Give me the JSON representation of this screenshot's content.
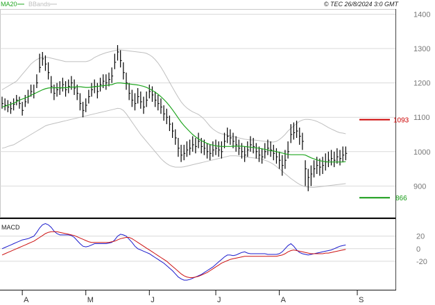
{
  "legend": {
    "ma_label": "MA20",
    "bbands_label": "BBands",
    "ma_color": "#1fa51f",
    "bbands_color": "#bfbfbf"
  },
  "header": {
    "copyright": "© TEC 26/8/2024 3:0 GMT"
  },
  "macd_panel": {
    "label": "MACD"
  },
  "colors": {
    "candles": "#000000",
    "resistance": "#cc0000",
    "support": "#119911",
    "macd_line": "#1a1acc",
    "signal_line": "#cc1111",
    "grid": "#d9d9d9",
    "axis_text": "#777777"
  },
  "chart_data": [
    {
      "type": "line",
      "title": "",
      "price_axis_ticks": [
        "1400",
        "1300",
        "1200",
        "1100",
        "1000",
        "900"
      ],
      "tick_values": [
        1400,
        1300,
        1200,
        1100,
        1000,
        900
      ],
      "ylim": [
        810,
        1415
      ],
      "x_tick_labels": [
        "A",
        "M",
        "J",
        "J",
        "A",
        "S"
      ],
      "x_ticks_index": [
        7,
        29,
        51,
        74,
        96,
        123
      ],
      "x_index_range": [
        0,
        126
      ],
      "grid": true,
      "levels": [
        {
          "name": "resistance",
          "value": 1093,
          "label": "1093"
        },
        {
          "name": "support",
          "value": 866,
          "label": "866"
        }
      ],
      "ohlc_close": [
        1140,
        1135,
        1130,
        1125,
        1138,
        1150,
        1140,
        1120,
        1145,
        1160,
        1175,
        1170,
        1200,
        1245,
        1270,
        1255,
        1230,
        1190,
        1170,
        1180,
        1185,
        1195,
        1180,
        1190,
        1200,
        1185,
        1170,
        1140,
        1120,
        1135,
        1160,
        1180,
        1190,
        1175,
        1195,
        1205,
        1200,
        1210,
        1220,
        1260,
        1290,
        1265,
        1230,
        1200,
        1170,
        1150,
        1140,
        1160,
        1145,
        1130,
        1150,
        1175,
        1165,
        1150,
        1140,
        1130,
        1110,
        1100,
        1080,
        1060,
        1040,
        1010,
        990,
        995,
        1005,
        1010,
        1020,
        1015,
        1030,
        1015,
        1010,
        1000,
        995,
        1005,
        1010,
        1005,
        1000,
        1030,
        1045,
        1040,
        1030,
        1020,
        1010,
        1000,
        990,
        1005,
        1020,
        1015,
        1000,
        990,
        985,
        1000,
        1010,
        1005,
        995,
        985,
        975,
        960,
        975,
        1000,
        1050,
        1055,
        1060,
        1045,
        1030,
        950,
        925,
        935,
        950,
        960,
        955,
        960,
        970,
        975,
        980,
        975,
        985,
        980,
        990,
        995
      ],
      "ohlc_high": [
        1160,
        1155,
        1150,
        1145,
        1155,
        1165,
        1160,
        1145,
        1165,
        1180,
        1195,
        1195,
        1225,
        1285,
        1290,
        1280,
        1260,
        1220,
        1195,
        1200,
        1205,
        1215,
        1205,
        1210,
        1220,
        1210,
        1195,
        1170,
        1145,
        1155,
        1180,
        1200,
        1210,
        1200,
        1215,
        1225,
        1225,
        1230,
        1245,
        1285,
        1310,
        1295,
        1260,
        1230,
        1200,
        1180,
        1170,
        1185,
        1175,
        1160,
        1175,
        1195,
        1190,
        1175,
        1165,
        1155,
        1135,
        1125,
        1105,
        1085,
        1065,
        1040,
        1020,
        1020,
        1030,
        1035,
        1045,
        1040,
        1055,
        1040,
        1035,
        1025,
        1020,
        1030,
        1035,
        1030,
        1030,
        1055,
        1070,
        1065,
        1055,
        1045,
        1035,
        1025,
        1015,
        1030,
        1045,
        1040,
        1025,
        1015,
        1010,
        1025,
        1035,
        1030,
        1020,
        1010,
        1000,
        990,
        1005,
        1030,
        1080,
        1085,
        1090,
        1070,
        1055,
        975,
        950,
        960,
        975,
        985,
        980,
        985,
        995,
        1000,
        1005,
        1000,
        1010,
        1005,
        1015,
        1015
      ],
      "ohlc_low": [
        1125,
        1120,
        1115,
        1110,
        1120,
        1135,
        1125,
        1105,
        1130,
        1140,
        1160,
        1155,
        1185,
        1230,
        1250,
        1235,
        1210,
        1170,
        1150,
        1160,
        1165,
        1175,
        1160,
        1170,
        1180,
        1165,
        1150,
        1120,
        1100,
        1115,
        1140,
        1160,
        1170,
        1155,
        1175,
        1185,
        1180,
        1190,
        1200,
        1240,
        1265,
        1245,
        1210,
        1180,
        1150,
        1130,
        1120,
        1140,
        1125,
        1110,
        1130,
        1155,
        1145,
        1130,
        1120,
        1110,
        1090,
        1080,
        1060,
        1040,
        1020,
        985,
        970,
        975,
        985,
        990,
        1000,
        995,
        1010,
        995,
        990,
        980,
        975,
        985,
        990,
        985,
        980,
        1010,
        1025,
        1020,
        1010,
        1000,
        990,
        980,
        970,
        985,
        1000,
        995,
        980,
        970,
        965,
        980,
        990,
        985,
        975,
        965,
        950,
        930,
        950,
        980,
        1025,
        1035,
        1040,
        1020,
        1005,
        900,
        885,
        900,
        925,
        935,
        930,
        935,
        945,
        955,
        960,
        955,
        965,
        960,
        970,
        975
      ],
      "series": [
        {
          "name": "MA20",
          "values": [
            1130,
            1132,
            1135,
            1138,
            1141,
            1145,
            1150,
            1153,
            1156,
            1160,
            1164,
            1168,
            1172,
            1176,
            1180,
            1183,
            1185,
            1186,
            1186,
            1186,
            1186,
            1186,
            1186,
            1187,
            1188,
            1188,
            1189,
            1189,
            1188,
            1187,
            1187,
            1188,
            1189,
            1190,
            1191,
            1192,
            1193,
            1194,
            1195,
            1198,
            1200,
            1200,
            1199,
            1198,
            1197,
            1196,
            1195,
            1194,
            1192,
            1190,
            1187,
            1183,
            1178,
            1173,
            1167,
            1160,
            1152,
            1143,
            1133,
            1122,
            1110,
            1098,
            1086,
            1076,
            1067,
            1058,
            1050,
            1043,
            1037,
            1032,
            1028,
            1024,
            1021,
            1019,
            1017,
            1016,
            1015,
            1015,
            1015,
            1015,
            1016,
            1016,
            1016,
            1016,
            1015,
            1014,
            1013,
            1012,
            1011,
            1010,
            1008,
            1007,
            1005,
            1003,
            1002,
            1000,
            998,
            996,
            994,
            992,
            991,
            991,
            991,
            991,
            991,
            990,
            986,
            982,
            979,
            976,
            974,
            972,
            971,
            970,
            970,
            970,
            970,
            970,
            970,
            971
          ]
        },
        {
          "name": "BBands",
          "values": [
            1180,
            1185,
            1190,
            1195,
            1200,
            1205,
            1215,
            1225,
            1235,
            1245,
            1255,
            1262,
            1268,
            1272,
            1274,
            1275,
            1274,
            1272,
            1270,
            1268,
            1266,
            1264,
            1262,
            1262,
            1262,
            1262,
            1262,
            1262,
            1262,
            1262,
            1264,
            1268,
            1274,
            1278,
            1282,
            1285,
            1288,
            1290,
            1292,
            1294,
            1296,
            1296,
            1295,
            1294,
            1293,
            1292,
            1291,
            1290,
            1289,
            1288,
            1286,
            1282,
            1276,
            1268,
            1258,
            1246,
            1232,
            1217,
            1202,
            1187,
            1172,
            1158,
            1145,
            1135,
            1127,
            1121,
            1116,
            1112,
            1108,
            1102,
            1094,
            1084,
            1074,
            1066,
            1060,
            1055,
            1052,
            1050,
            1048,
            1046,
            1044,
            1042,
            1040,
            1038,
            1036,
            1035,
            1034,
            1034,
            1033,
            1032,
            1031,
            1030,
            1029,
            1028,
            1028,
            1030,
            1035,
            1042,
            1050,
            1060,
            1068,
            1075,
            1082,
            1088,
            1092,
            1094,
            1094,
            1093,
            1091,
            1088,
            1084,
            1080,
            1075,
            1070,
            1066,
            1062,
            1058,
            1055,
            1054,
            1052
          ]
        },
        {
          "name": "BBands-lower",
          "values": [
            1010,
            1012,
            1015,
            1018,
            1020,
            1025,
            1030,
            1035,
            1040,
            1045,
            1050,
            1055,
            1060,
            1065,
            1070,
            1075,
            1078,
            1080,
            1082,
            1084,
            1086,
            1088,
            1090,
            1092,
            1094,
            1096,
            1098,
            1100,
            1102,
            1104,
            1106,
            1108,
            1110,
            1112,
            1114,
            1116,
            1118,
            1120,
            1122,
            1124,
            1126,
            1125,
            1120,
            1110,
            1098,
            1086,
            1074,
            1062,
            1050,
            1040,
            1030,
            1020,
            1010,
            1000,
            990,
            980,
            972,
            965,
            960,
            957,
            955,
            955,
            955,
            956,
            958,
            960,
            962,
            964,
            966,
            968,
            970,
            972,
            974,
            976,
            978,
            980,
            982,
            984,
            986,
            988,
            988,
            988,
            987,
            986,
            985,
            984,
            983,
            982,
            981,
            980,
            978,
            975,
            972,
            968,
            963,
            957,
            950,
            943,
            936,
            929,
            922,
            916,
            910,
            905,
            901,
            898,
            897,
            896,
            896,
            897,
            898,
            899,
            900,
            901,
            902,
            903,
            904,
            905,
            906,
            907
          ]
        }
      ]
    },
    {
      "type": "line",
      "title": "MACD",
      "ytick_labels": [
        "20",
        "0",
        "-20"
      ],
      "ytick_values": [
        20,
        0,
        -20
      ],
      "ylim": [
        -62,
        45
      ],
      "series": [
        {
          "name": "MACD",
          "values": [
            0,
            2,
            4,
            6,
            8,
            10,
            12,
            14,
            15,
            16,
            18,
            20,
            26,
            33,
            38,
            40,
            38,
            34,
            28,
            24,
            22,
            22,
            22,
            22,
            21,
            18,
            13,
            8,
            4,
            3,
            4,
            6,
            8,
            8,
            8,
            8,
            8,
            9,
            10,
            14,
            20,
            23,
            22,
            20,
            15,
            10,
            4,
            0,
            -2,
            -4,
            -6,
            -8,
            -11,
            -14,
            -17,
            -20,
            -23,
            -27,
            -31,
            -35,
            -40,
            -45,
            -48,
            -50,
            -50,
            -49,
            -47,
            -45,
            -43,
            -41,
            -38,
            -35,
            -32,
            -29,
            -25,
            -21,
            -17,
            -13,
            -10,
            -10,
            -11,
            -10,
            -8,
            -6,
            -5,
            -7,
            -8,
            -8,
            -8,
            -8,
            -8,
            -8,
            -9,
            -9,
            -9,
            -9,
            -8,
            -5,
            0,
            5,
            8,
            4,
            -2,
            -6,
            -8,
            -9,
            -10,
            -9,
            -8,
            -7,
            -6,
            -5,
            -4,
            -3,
            -2,
            0,
            2,
            4,
            5,
            6
          ]
        },
        {
          "name": "Signal",
          "values": [
            -10,
            -8,
            -6,
            -4,
            -2,
            0,
            2,
            4,
            6,
            8,
            10,
            12,
            15,
            18,
            21,
            24,
            26,
            27,
            27,
            27,
            26,
            25,
            24,
            23,
            22,
            21,
            19,
            17,
            15,
            13,
            11,
            10,
            10,
            10,
            10,
            10,
            10,
            10,
            11,
            12,
            14,
            16,
            17,
            18,
            18,
            16,
            13,
            10,
            7,
            4,
            1,
            -2,
            -5,
            -8,
            -11,
            -14,
            -17,
            -20,
            -24,
            -28,
            -32,
            -36,
            -40,
            -43,
            -45,
            -46,
            -46,
            -45,
            -44,
            -42,
            -40,
            -38,
            -35,
            -32,
            -29,
            -26,
            -23,
            -21,
            -19,
            -17,
            -16,
            -15,
            -14,
            -13,
            -12,
            -12,
            -12,
            -12,
            -12,
            -12,
            -12,
            -12,
            -12,
            -12,
            -12,
            -12,
            -11,
            -10,
            -8,
            -5,
            -3,
            -2,
            -3,
            -4,
            -5,
            -6,
            -7,
            -8,
            -8,
            -8,
            -8,
            -8,
            -7,
            -7,
            -6,
            -5,
            -4,
            -3,
            -2,
            -1
          ]
        }
      ]
    }
  ]
}
